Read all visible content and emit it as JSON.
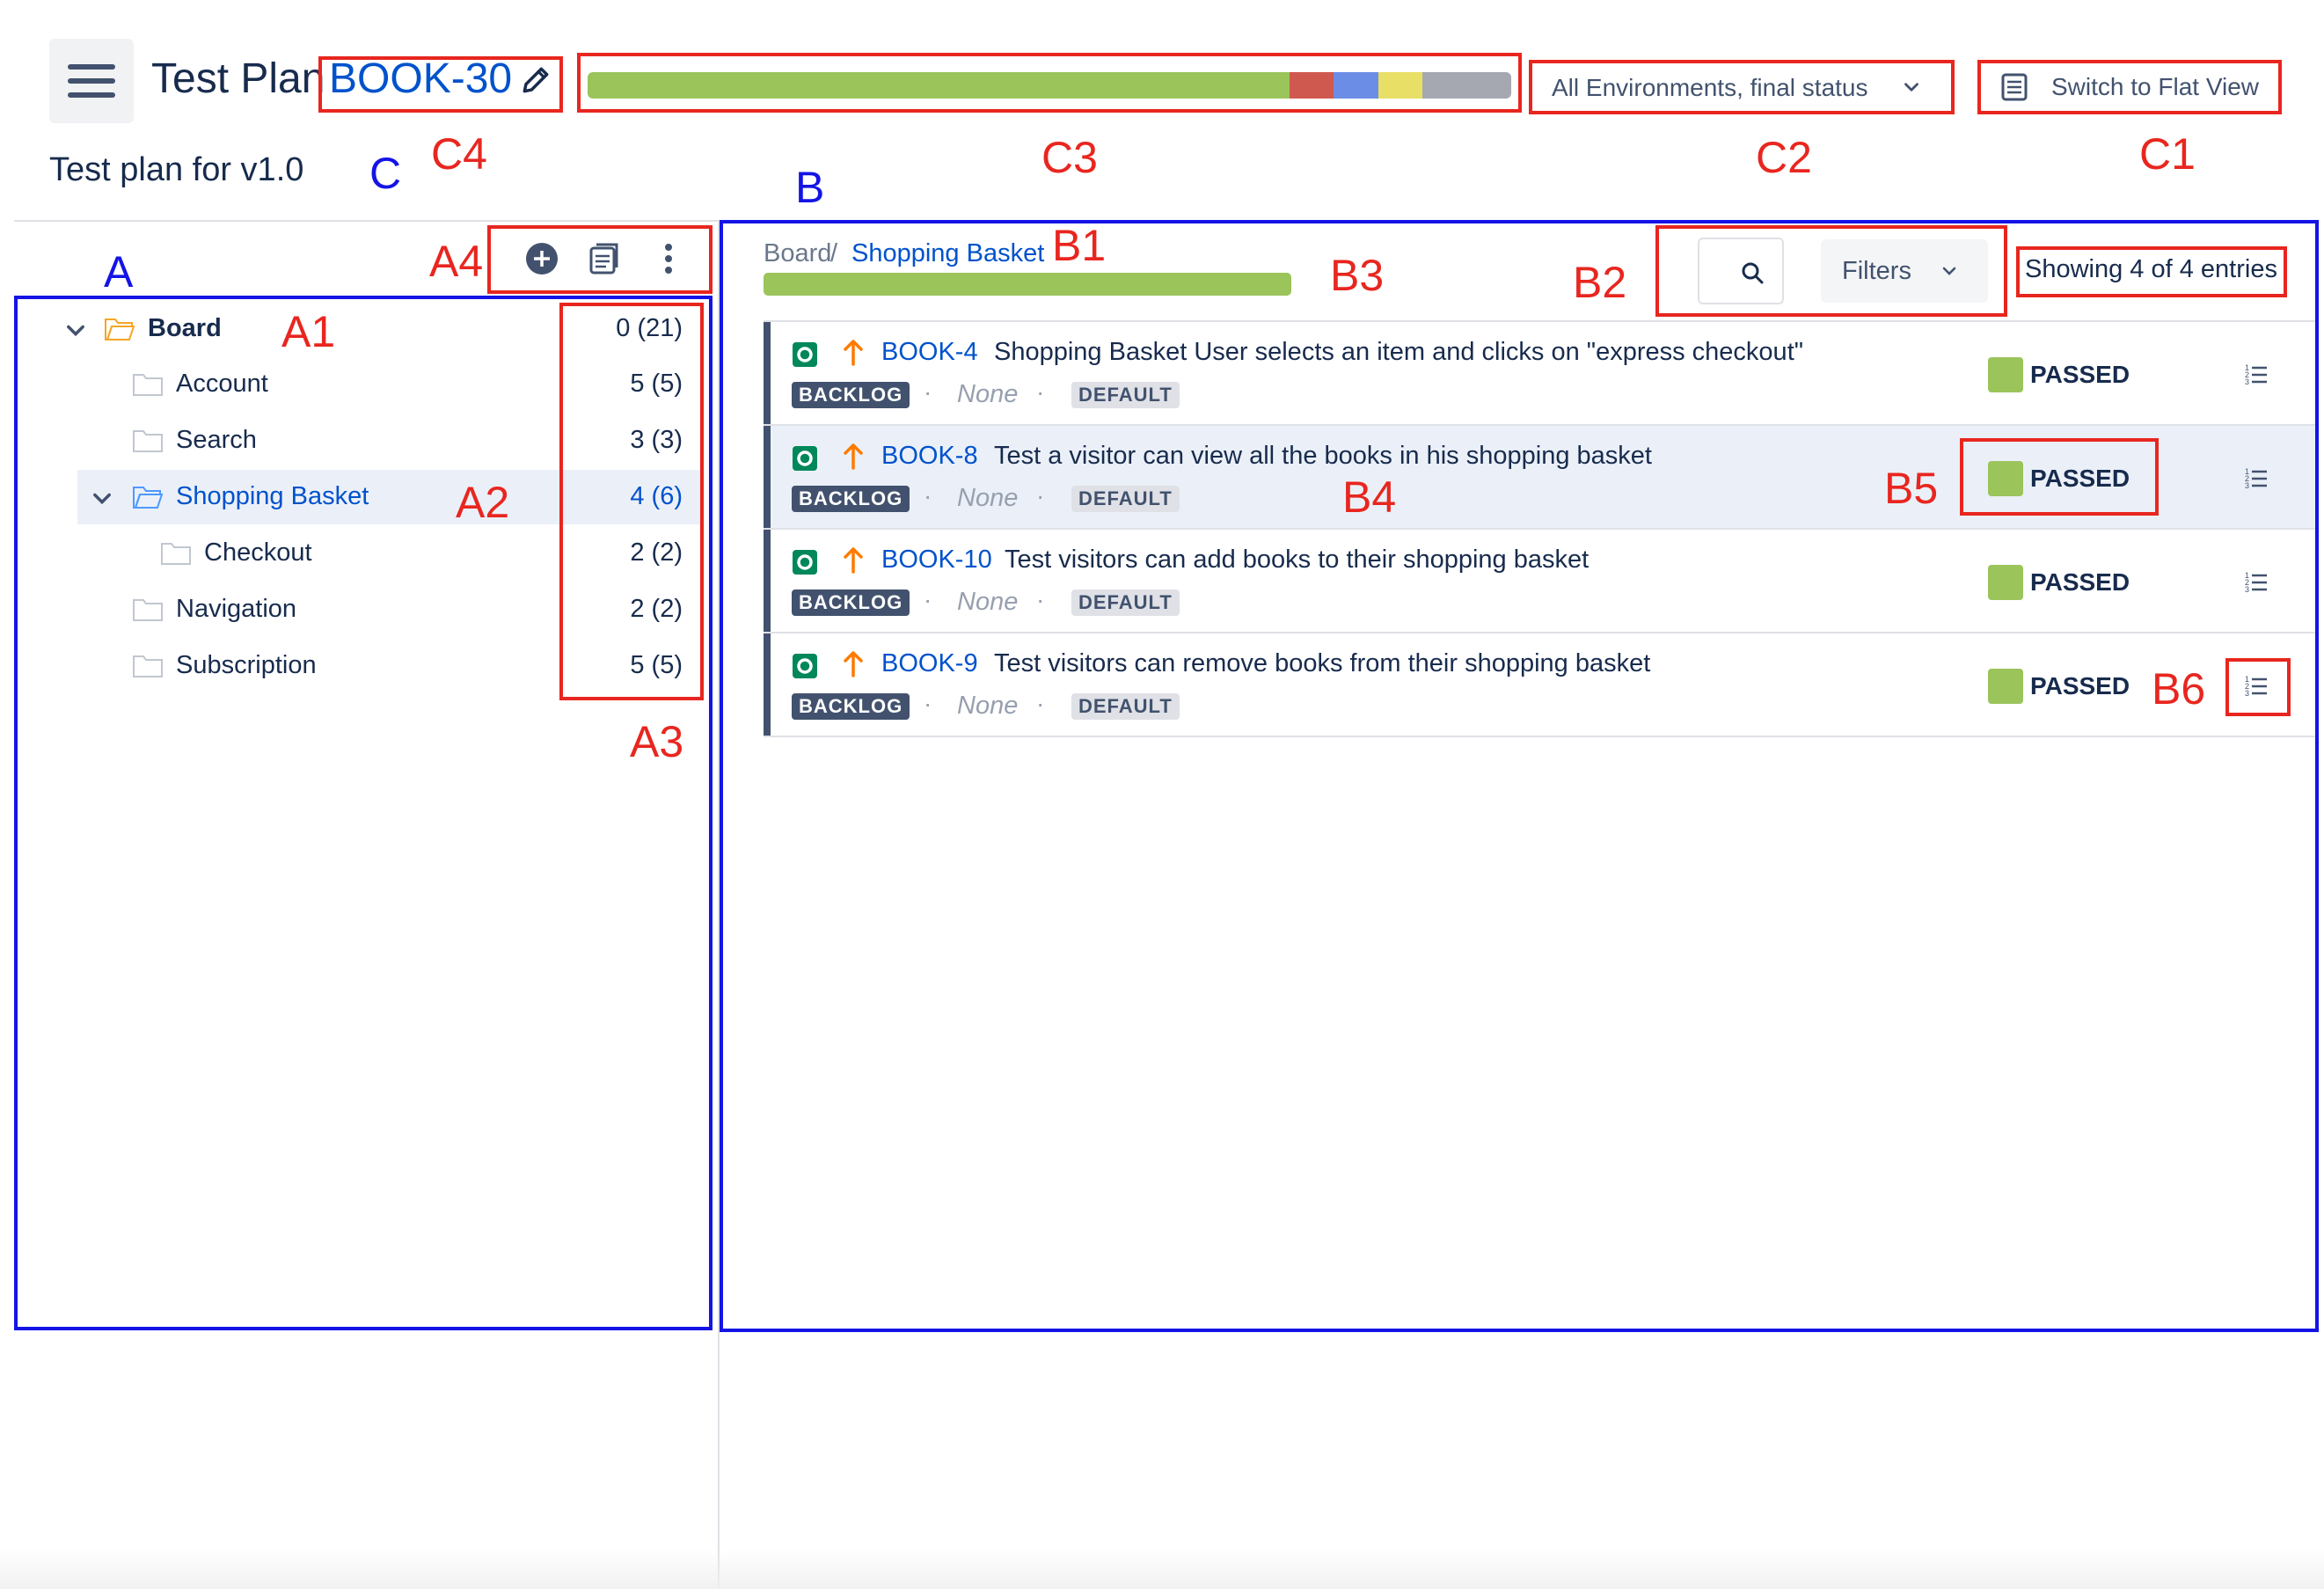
{
  "header": {
    "title_prefix": "Test Plan",
    "plan_key": "BOOK-30",
    "env_select": "All Environments, final status",
    "flat_view_label": "Switch to Flat View",
    "plan_description": "Test plan for v1.0",
    "progress_segments": [
      {
        "status": "passed",
        "color": "#9bc45b",
        "fraction": 0.76
      },
      {
        "status": "failed",
        "color": "#d0594f",
        "fraction": 0.048
      },
      {
        "status": "executing",
        "color": "#6b8de6",
        "fraction": 0.048
      },
      {
        "status": "todo",
        "color": "#e8df66",
        "fraction": 0.048
      },
      {
        "status": "other",
        "color": "#a5a8b0",
        "fraction": 0.096
      }
    ]
  },
  "tree": {
    "toolbar_icons": [
      "add-folder-icon",
      "copy-icon",
      "more-icon"
    ],
    "items": [
      {
        "label": "Board",
        "count": "0 (21)",
        "expanded": true,
        "bold": true
      },
      {
        "label": "Account",
        "count": "5 (5)"
      },
      {
        "label": "Search",
        "count": "3 (3)"
      },
      {
        "label": "Shopping Basket",
        "count": "4 (6)",
        "expanded": true,
        "selected": true
      },
      {
        "label": "Checkout",
        "count": "2 (2)"
      },
      {
        "label": "Navigation",
        "count": "2 (2)"
      },
      {
        "label": "Subscription",
        "count": "5 (5)"
      }
    ]
  },
  "main": {
    "breadcrumb_root": "Board",
    "breadcrumb_separator": "/",
    "breadcrumb_current": "Shopping Basket",
    "folder_progress_passed_fraction": 1.0,
    "filters_label": "Filters",
    "entries_text": "Showing 4 of 4 entries",
    "tests": [
      {
        "key": "BOOK-4",
        "summary": "Shopping Basket User selects an item and clicks on \"express checkout\"",
        "status_badge": "BACKLOG",
        "assignee": "None",
        "environment": "DEFAULT",
        "result": "PASSED"
      },
      {
        "key": "BOOK-8",
        "summary": "Test a visitor can view all the books in his shopping basket",
        "status_badge": "BACKLOG",
        "assignee": "None",
        "environment": "DEFAULT",
        "result": "PASSED"
      },
      {
        "key": "BOOK-10",
        "summary": "Test visitors can add books to their shopping basket",
        "status_badge": "BACKLOG",
        "assignee": "None",
        "environment": "DEFAULT",
        "result": "PASSED"
      },
      {
        "key": "BOOK-9",
        "summary": "Test visitors can remove books from their shopping basket",
        "status_badge": "BACKLOG",
        "assignee": "None",
        "environment": "DEFAULT",
        "result": "PASSED"
      }
    ]
  },
  "annotations": {
    "A": "A",
    "A1": "A1",
    "A2": "A2",
    "A3": "A3",
    "A4": "A4",
    "B": "B",
    "B1": "B1",
    "B2": "B2",
    "B3": "B3",
    "B4": "B4",
    "B5": "B5",
    "B6": "B6",
    "C": "C",
    "C1": "C1",
    "C2": "C2",
    "C3": "C3",
    "C4": "C4",
    "red_color": "#e8261f",
    "blue_color": "#1414e6"
  }
}
